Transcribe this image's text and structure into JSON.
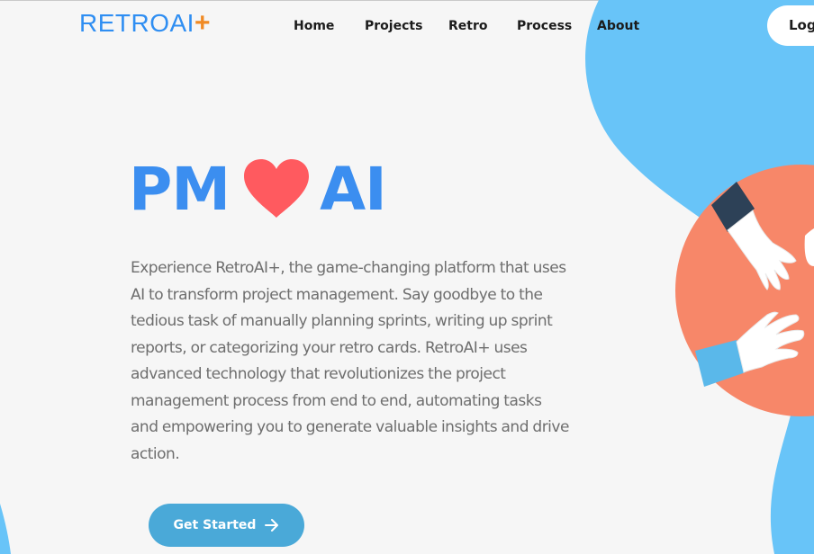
{
  "header": {
    "logo_text": "RETROAI",
    "logo_plus": "+",
    "nav": [
      {
        "label": "Home"
      },
      {
        "label": "Projects"
      },
      {
        "label": "Retro"
      },
      {
        "label": "Process"
      },
      {
        "label": "About"
      }
    ],
    "login_label": "Log"
  },
  "hero": {
    "title_left": "PM",
    "title_right": "AI",
    "description": "Experience RetroAI+, the game-changing platform that uses AI to transform project management. Say goodbye to the tedious task of manually planning sprints, writing up sprint reports, or categorizing your retro cards. RetroAI+ uses advanced technology that revolutionizes the project management process from end to end, automating tasks and empowering you to generate valuable insights and drive action.",
    "cta_label": "Get Started"
  },
  "colors": {
    "brand_blue": "#2f8ef2",
    "plus_orange": "#f08a24",
    "heart_red": "#ff5a5f",
    "blob_blue": "#68c4f8",
    "circle_salmon": "#f78769",
    "cta_blue": "#4aa9d8"
  },
  "icons": {
    "heart": "heart-icon",
    "arrow": "arrow-right-icon",
    "hands": "handshake-illustration"
  }
}
